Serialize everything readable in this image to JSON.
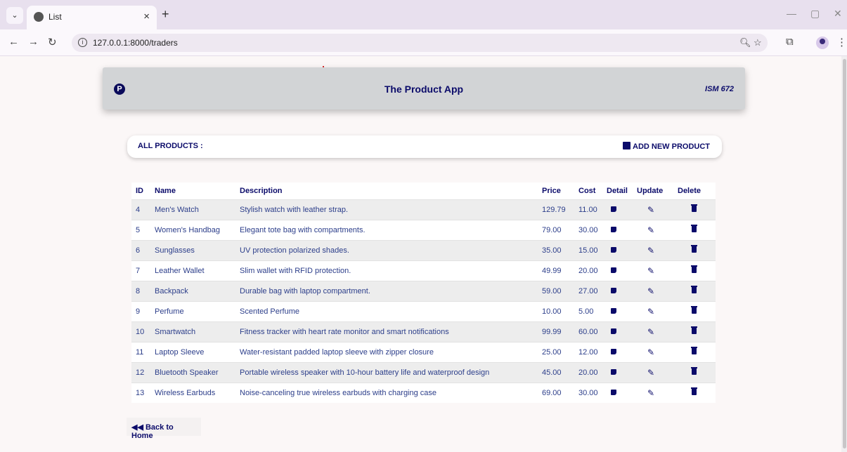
{
  "browser": {
    "tab_title": "List",
    "tab_close": "×",
    "new_tab": "+",
    "url": "127.0.0.1:8000/traders",
    "window_minimize": "—",
    "window_restore": "▢",
    "window_close": "✕"
  },
  "header": {
    "logo_letter": "P",
    "title": "The Product App",
    "course": "ISM 672"
  },
  "section": {
    "title": "ALL PRODUCTS :",
    "add_button": "ADD NEW PRODUCT"
  },
  "table": {
    "columns": [
      "ID",
      "Name",
      "Description",
      "Price",
      "Cost",
      "Detail",
      "Update",
      "Delete"
    ],
    "rows": [
      {
        "id": "4",
        "name": "Men's Watch",
        "description": "Stylish watch with leather strap.",
        "price": "129.79",
        "cost": "11.00"
      },
      {
        "id": "5",
        "name": "Women's Handbag",
        "description": "Elegant tote bag with compartments.",
        "price": "79.00",
        "cost": "30.00"
      },
      {
        "id": "6",
        "name": "Sunglasses",
        "description": "UV protection polarized shades.",
        "price": "35.00",
        "cost": "15.00"
      },
      {
        "id": "7",
        "name": "Leather Wallet",
        "description": "Slim wallet with RFID protection.",
        "price": "49.99",
        "cost": "20.00"
      },
      {
        "id": "8",
        "name": "Backpack",
        "description": "Durable bag with laptop compartment.",
        "price": "59.00",
        "cost": "27.00"
      },
      {
        "id": "9",
        "name": "Perfume",
        "description": "Scented Perfume",
        "price": "10.00",
        "cost": "5.00"
      },
      {
        "id": "10",
        "name": "Smartwatch",
        "description": "Fitness tracker with heart rate monitor and smart notifications",
        "price": "99.99",
        "cost": "60.00"
      },
      {
        "id": "11",
        "name": "Laptop Sleeve",
        "description": "Water-resistant padded laptop sleeve with zipper closure",
        "price": "25.00",
        "cost": "12.00"
      },
      {
        "id": "12",
        "name": "Bluetooth Speaker",
        "description": "Portable wireless speaker with 10-hour battery life and waterproof design",
        "price": "45.00",
        "cost": "20.00"
      },
      {
        "id": "13",
        "name": "Wireless Earbuds",
        "description": "Noise-canceling true wireless earbuds with charging case",
        "price": "69.00",
        "cost": "30.00"
      }
    ]
  },
  "footer": {
    "back_button": "◀◀ Back to Home"
  },
  "icons": {
    "detail": "detail-icon",
    "update": "pencil-icon",
    "delete": "trash-icon"
  },
  "colors": {
    "accent": "#0b0b6a",
    "header_bg": "#d2d4d6"
  }
}
